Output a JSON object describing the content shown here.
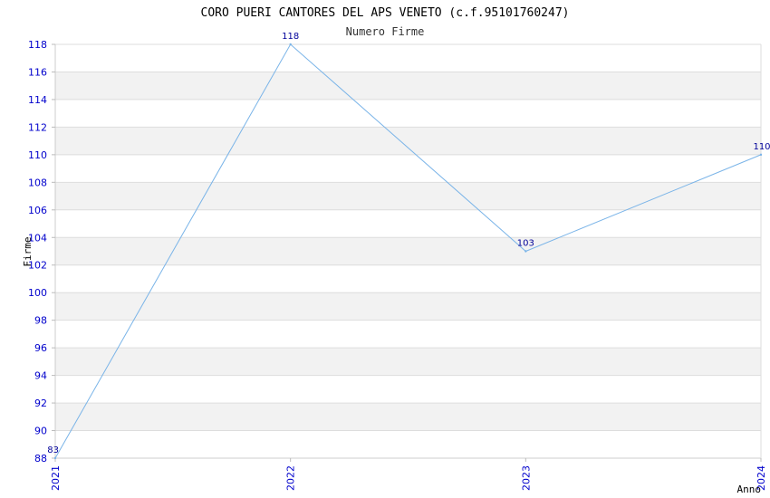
{
  "chart_data": {
    "type": "line",
    "title": "CORO PUERI CANTORES DEL APS VENETO (c.f.95101760247)",
    "subtitle": "Numero Firme",
    "xlabel": "Anno",
    "ylabel": "Firme",
    "categories": [
      "2021",
      "2022",
      "2023",
      "2024"
    ],
    "series": [
      {
        "values": [
          88,
          118,
          103,
          110
        ]
      }
    ],
    "data_labels": [
      "83",
      "118",
      "103",
      "110"
    ],
    "ylim": [
      88,
      118
    ],
    "ytick_step": 2,
    "grid": true,
    "colors": {
      "line": "#7ab4e8",
      "band": "#f2f2f2",
      "grid": "#dddddd",
      "tick_label": "#0000cc",
      "data_label": "#000099"
    }
  }
}
